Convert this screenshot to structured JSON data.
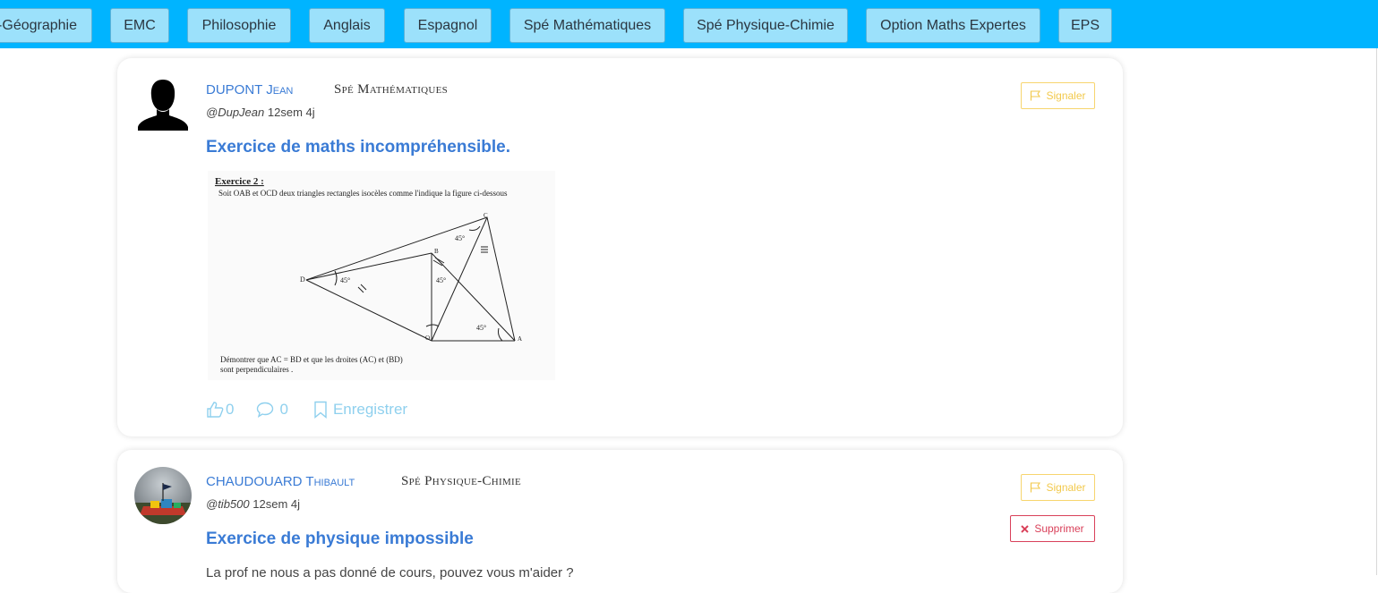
{
  "subjects": [
    "Histoire-Géographie",
    "EMC",
    "Philosophie",
    "Anglais",
    "Espagnol",
    "Spé Mathématiques",
    "Spé Physique-Chimie",
    "Option Maths Expertes",
    "EPS"
  ],
  "subjects_visible": [
    "-Géographie",
    "EMC",
    "Philosophie",
    "Anglais",
    "Espagnol",
    "Spé Mathématiques",
    "Spé Physique-Chimie",
    "Option Maths Expertes",
    "EPS"
  ],
  "posts": [
    {
      "author": "DUPONT Jean",
      "subject": "Spé Mathématiques",
      "handle": "@DupJean",
      "age": "12sem 4j",
      "title": "Exercice de maths incompréhensible.",
      "report_label": "Signaler",
      "image": {
        "heading": "Exercice 2 :",
        "statement": "Soit OAB et OCD deux triangles rectangles isocèles comme l'indique la figure ci-dessous",
        "question_line1": "Démontrer que  AC = BD  et que les droites (AC) et (BD)",
        "question_line2": "sont perpendiculaires .",
        "points": [
          "C",
          "B",
          "D",
          "O",
          "A"
        ],
        "angles": [
          "45°",
          "45°",
          "45°",
          "45°"
        ]
      },
      "likes": "0",
      "comments": "0",
      "save_label": "Enregistrer"
    },
    {
      "author": "CHAUDOUARD Thibault",
      "subject": "Spé Physique-Chimie",
      "handle": "@tib500",
      "age": "12sem 4j",
      "title": "Exercice de physique impossible",
      "report_label": "Signaler",
      "delete_label": "Supprimer",
      "body": "La prof ne nous a pas donné de cours, pouvez vous m'aider ?"
    }
  ],
  "colors": {
    "topbar": "#00b4ff",
    "chip": "#9ce1fb",
    "link": "#3a7bd5",
    "report": "#f2c94c",
    "delete": "#d9415a",
    "action": "#8fd0ee"
  }
}
